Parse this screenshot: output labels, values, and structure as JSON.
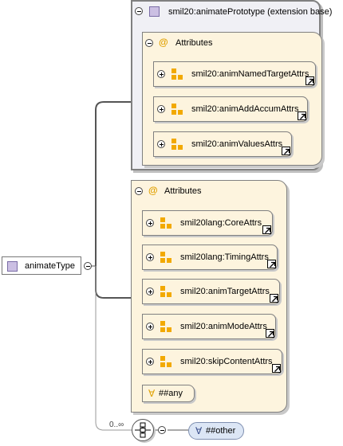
{
  "root": {
    "label": "animateType"
  },
  "extension": {
    "title": "smil20:animatePrototype (extension base)"
  },
  "ext_attributes": {
    "label": "Attributes",
    "groups": [
      "smil20:animNamedTargetAttrs",
      "smil20:animAddAccumAttrs",
      "smil20:animValuesAttrs"
    ]
  },
  "attributes": {
    "label": "Attributes",
    "groups": [
      "smil20lang:CoreAttrs",
      "smil20lang:TimingAttrs",
      "smil20:animTargetAttrs",
      "smil20:animModeAttrs",
      "smil20:skipContentAttrs"
    ],
    "any_label": "##any"
  },
  "sequence": {
    "cardinality": "0..∞",
    "other_label": "##other"
  },
  "colors": {
    "extension_bg": "#f0f0f5",
    "attributes_bg": "#fdf4de",
    "wildcard_bg": "#dce6f5",
    "group_icon": "#f2a900"
  }
}
